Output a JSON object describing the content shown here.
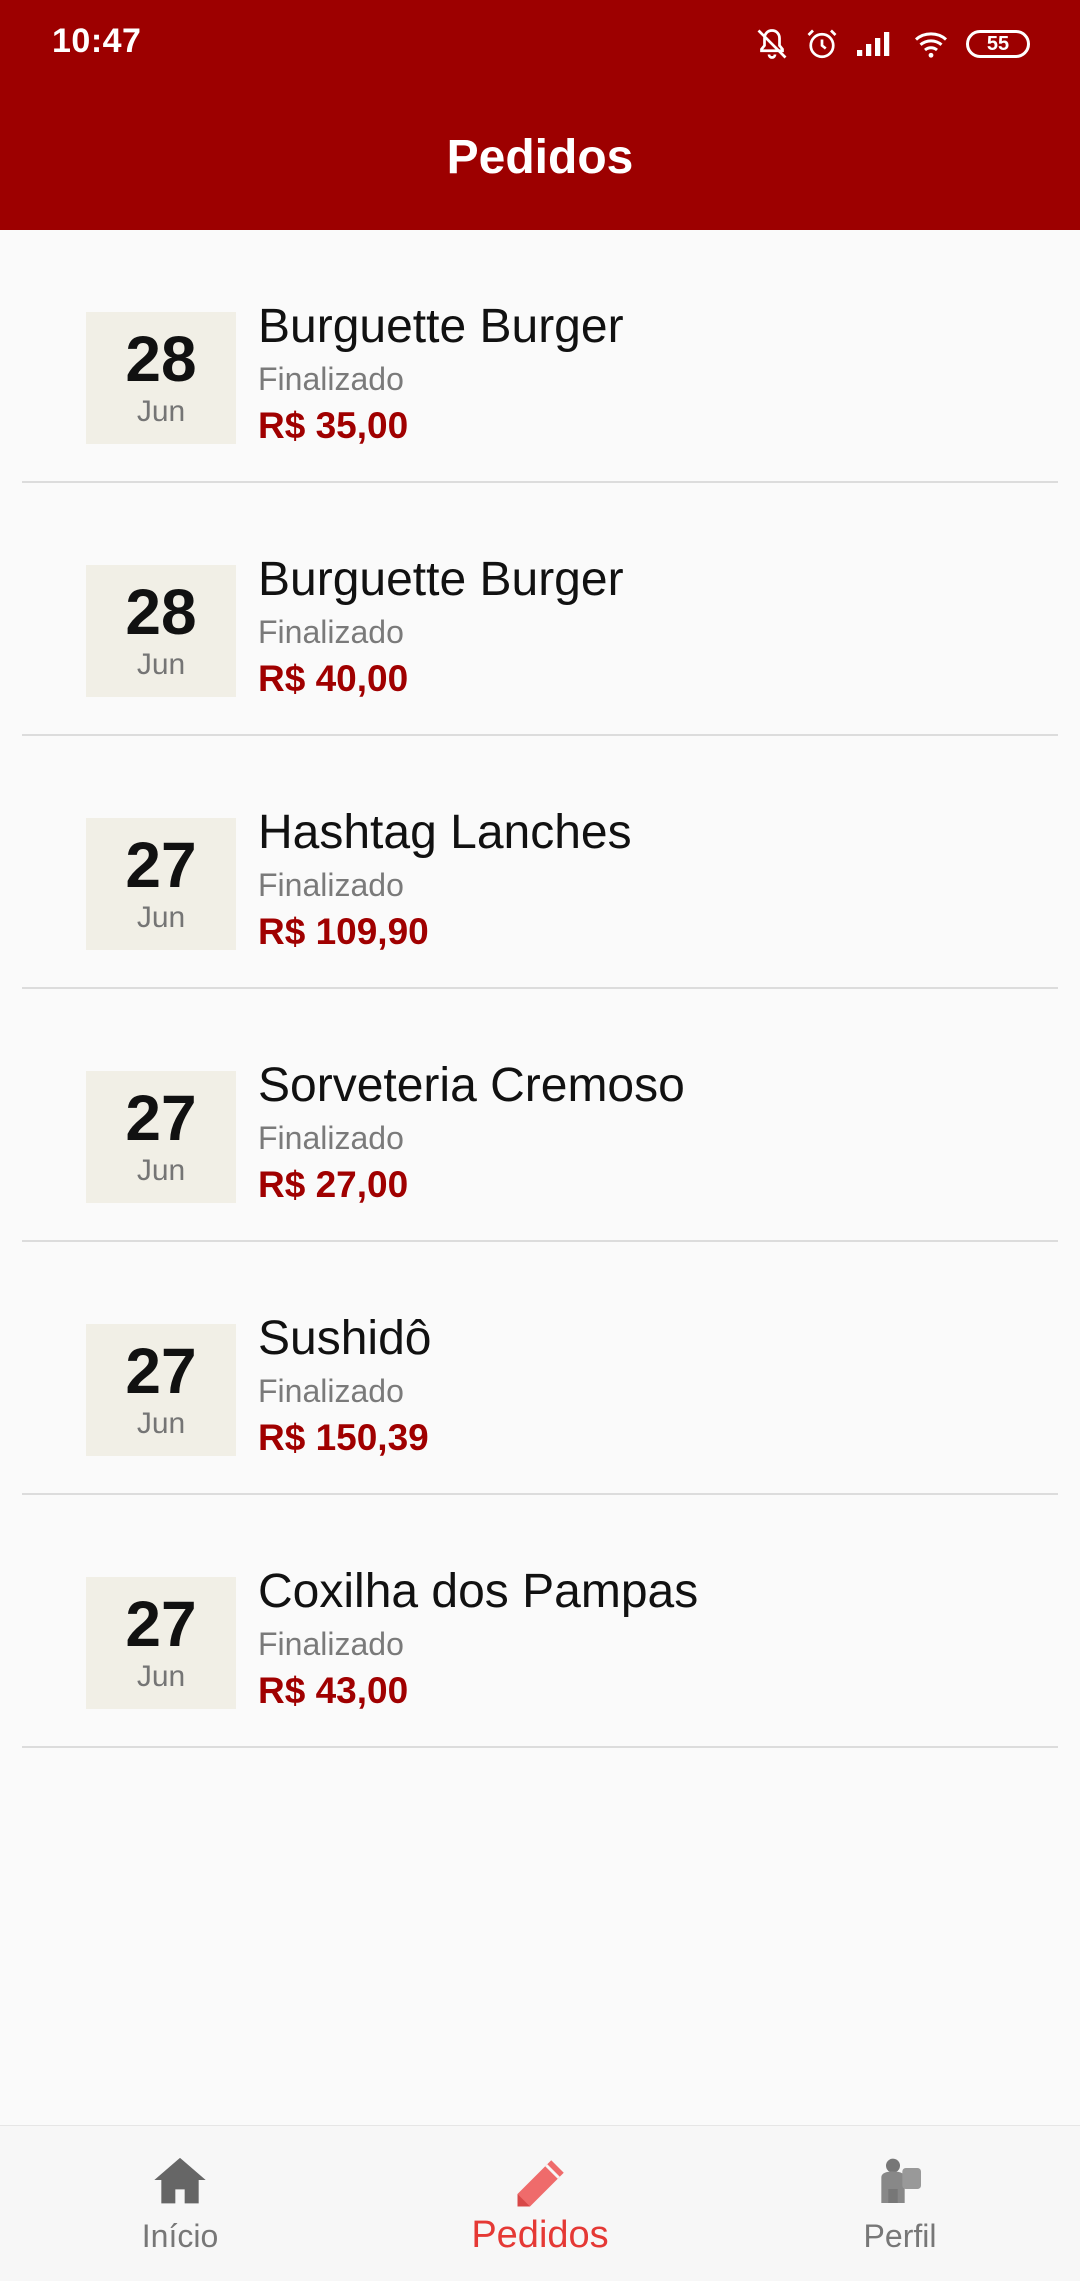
{
  "status_bar": {
    "time": "10:47",
    "battery": "55",
    "icons": [
      "notifications-off-icon",
      "alarm-icon",
      "signal-icon",
      "wifi-icon",
      "battery-icon"
    ]
  },
  "header": {
    "title": "Pedidos"
  },
  "orders": [
    {
      "day": "28",
      "month": "Jun",
      "store": "Burguette Burger",
      "status": "Finalizado",
      "price": "R$ 35,00"
    },
    {
      "day": "28",
      "month": "Jun",
      "store": "Burguette Burger",
      "status": "Finalizado",
      "price": "R$ 40,00"
    },
    {
      "day": "27",
      "month": "Jun",
      "store": "Hashtag Lanches",
      "status": "Finalizado",
      "price": "R$ 109,90"
    },
    {
      "day": "27",
      "month": "Jun",
      "store": "Sorveteria Cremoso",
      "status": "Finalizado",
      "price": "R$ 27,00"
    },
    {
      "day": "27",
      "month": "Jun",
      "store": "Sushidô",
      "status": "Finalizado",
      "price": "R$ 150,39"
    },
    {
      "day": "27",
      "month": "Jun",
      "store": "Coxilha dos Pampas",
      "status": "Finalizado",
      "price": "R$ 43,00"
    }
  ],
  "bottom_nav": {
    "items": [
      {
        "label": "Início",
        "icon": "home-icon",
        "active": false
      },
      {
        "label": "Pedidos",
        "icon": "pencil-icon",
        "active": true
      },
      {
        "label": "Perfil",
        "icon": "profile-icon",
        "active": false
      }
    ]
  },
  "colors": {
    "primary": "#9d0000",
    "price": "#a00000",
    "active_tab": "#e53935",
    "date_box": "#f1efe6"
  }
}
